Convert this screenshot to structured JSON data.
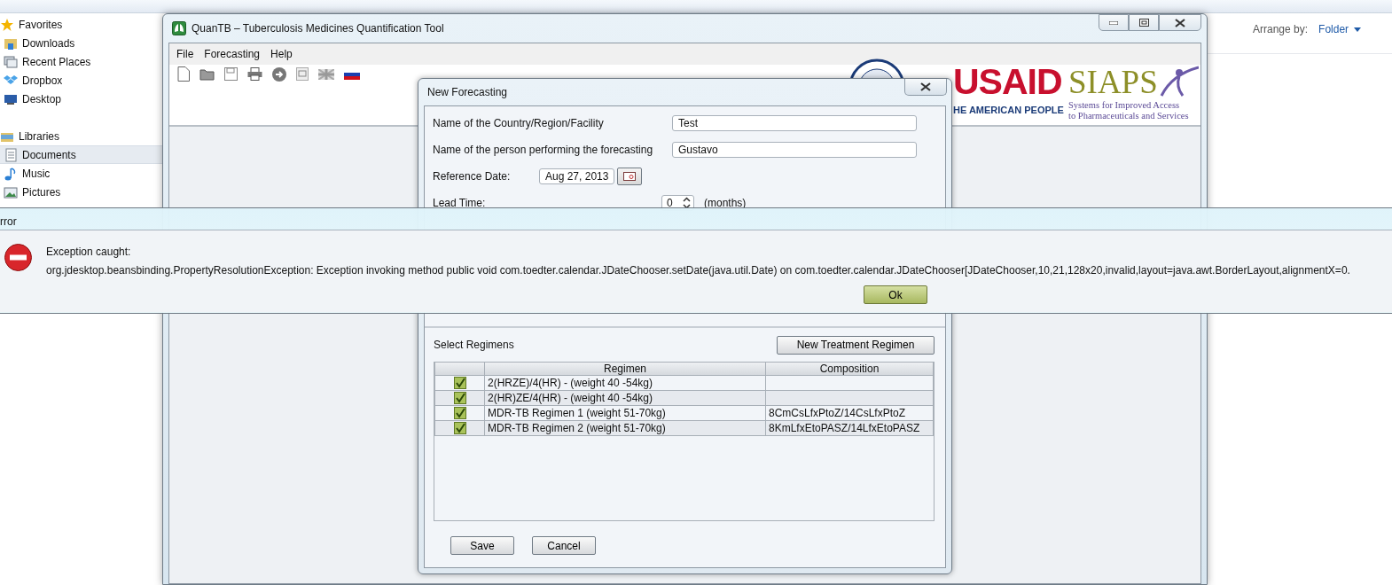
{
  "explorer": {
    "nav_items": [
      {
        "label": "Favorites",
        "kind": "group",
        "selected": false
      },
      {
        "label": "Downloads",
        "kind": "item",
        "selected": false
      },
      {
        "label": "Recent Places",
        "kind": "item",
        "selected": false
      },
      {
        "label": "Dropbox",
        "kind": "item",
        "selected": false
      },
      {
        "label": "Desktop",
        "kind": "item",
        "selected": false
      },
      {
        "label": "Libraries",
        "kind": "group",
        "selected": false
      },
      {
        "label": "Documents",
        "kind": "item",
        "selected": true
      },
      {
        "label": "Music",
        "kind": "item",
        "selected": false
      },
      {
        "label": "Pictures",
        "kind": "item",
        "selected": false
      }
    ],
    "arrange_by_label": "Arrange by:",
    "arrange_by_value": "Folder"
  },
  "app_window": {
    "title": "QuanTB – Tuberculosis Medicines Quantification Tool",
    "menu": [
      "File",
      "Forecasting",
      "Help"
    ],
    "logos": {
      "usaid": "USAID",
      "usaid_tagline": "HE AMERICAN PEOPLE",
      "siaps": "SIAPS",
      "siaps_tagline_1": "Systems for Improved Access",
      "siaps_tagline_2": "to Pharmaceuticals and Services"
    }
  },
  "new_forecasting_dialog": {
    "title": "New Forecasting",
    "country_label": "Name of the Country/Region/Facility",
    "country_value": "Test",
    "person_label": "Name of the person performing the forecasting",
    "person_value": "Gustavo",
    "reference_date_label": "Reference Date:",
    "reference_date_value": "Aug 27, 2013",
    "lead_time_label": "Lead Time:",
    "lead_time_value": "0",
    "lead_time_unit": "(months)",
    "select_regimens_label": "Select Regimens",
    "new_regimen_button": "New Treatment Regimen",
    "columns": [
      "Regimen",
      "Composition"
    ],
    "rows": [
      {
        "checked": true,
        "regimen": "2(HRZE)/4(HR) - (weight 40 -54kg)"
      },
      {
        "checked": true,
        "regimen": "2(HR)ZE/4(HR) - (weight 40 -54kg)"
      },
      {
        "checked": true,
        "regimen": "MDR-TB Regimen 1 (weight 51-70kg)",
        "composition": "8CmCsLfxPtoZ/14CsLfxPtoZ"
      },
      {
        "checked": true,
        "regimen": "MDR-TB Regimen 2 (weight 51-70kg)",
        "composition": "8KmLfxEtoPASZ/14LfxEtoPASZ"
      }
    ],
    "buttons": [
      "Save",
      "Cancel"
    ]
  },
  "error_dialog": {
    "title": "rror",
    "heading": "Exception caught:",
    "message": "org.jdesktop.beansbinding.PropertyResolutionException: Exception invoking method public void com.toedter.calendar.JDateChooser.setDate(java.util.Date) on com.toedter.calendar.JDateChooser[JDateChooser,10,21,128x20,invalid,layout=java.awt.BorderLayout,alignmentX=0.",
    "button": "Ok"
  }
}
